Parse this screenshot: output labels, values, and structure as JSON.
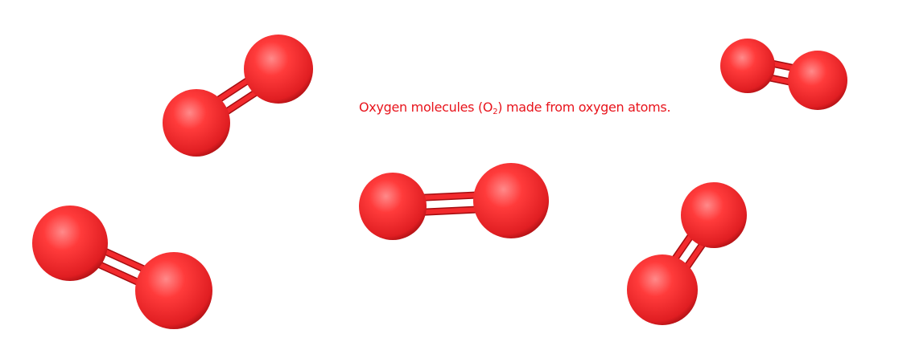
{
  "caption": {
    "before": "Oxygen molecules (O",
    "subscript": "2",
    "after": ") made from oxygen atoms."
  },
  "molecules": [
    {
      "name": "molecule-top-left"
    },
    {
      "name": "molecule-top-right"
    },
    {
      "name": "molecule-center"
    },
    {
      "name": "molecule-bottom-left"
    },
    {
      "name": "molecule-bottom-right"
    }
  ],
  "colors": {
    "atom": "#ff3b3b",
    "atom_highlight": "#ff8a8a",
    "atom_shadow": "#a80f12",
    "bond": "#f22a2d",
    "bond_shadow": "#a50d10",
    "caption": "#e8141c"
  }
}
